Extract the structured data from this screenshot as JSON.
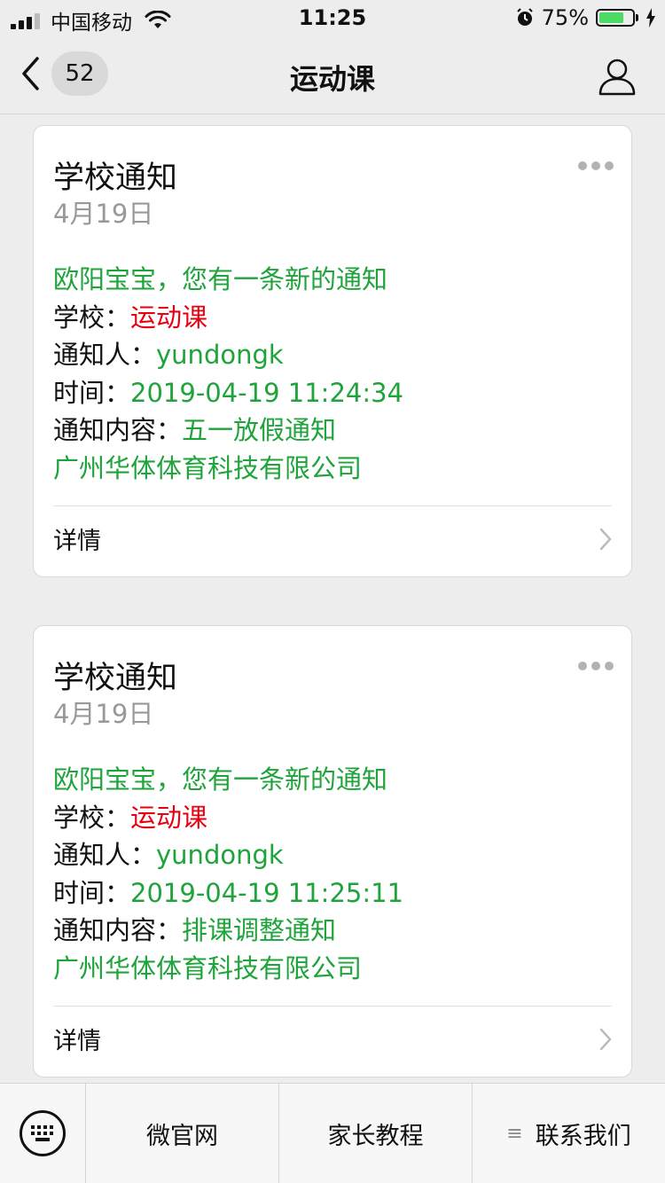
{
  "status": {
    "carrier": "中国移动",
    "time": "11:25",
    "battery": "75%",
    "battery_level": 0.75
  },
  "nav": {
    "badge": "52",
    "title": "运动课"
  },
  "cards": [
    {
      "title": "学校通知",
      "date": "4月19日",
      "greeting": "欧阳宝宝，您有一条新的通知",
      "school_label": "学校：",
      "school_value": "运动课",
      "notifier_label": "通知人：",
      "notifier_value": "yundongk",
      "time_label": "时间：",
      "time_value": "2019-04-19 11:24:34",
      "content_label": "通知内容：",
      "content_value": "五一放假通知",
      "company": "广州华体体育科技有限公司",
      "detail": "详情"
    },
    {
      "title": "学校通知",
      "date": "4月19日",
      "greeting": "欧阳宝宝，您有一条新的通知",
      "school_label": "学校：",
      "school_value": "运动课",
      "notifier_label": "通知人：",
      "notifier_value": "yundongk",
      "time_label": "时间：",
      "time_value": "2019-04-19 11:25:11",
      "content_label": "通知内容：",
      "content_value": "排课调整通知",
      "company": "广州华体体育科技有限公司",
      "detail": "详情"
    }
  ],
  "bottom_menu": {
    "item1": "微官网",
    "item2": "家长教程",
    "item3": "联系我们",
    "item3_icon": "≡"
  },
  "colors": {
    "green": "#1fa33b",
    "red": "#e60012",
    "background": "#ededed"
  }
}
